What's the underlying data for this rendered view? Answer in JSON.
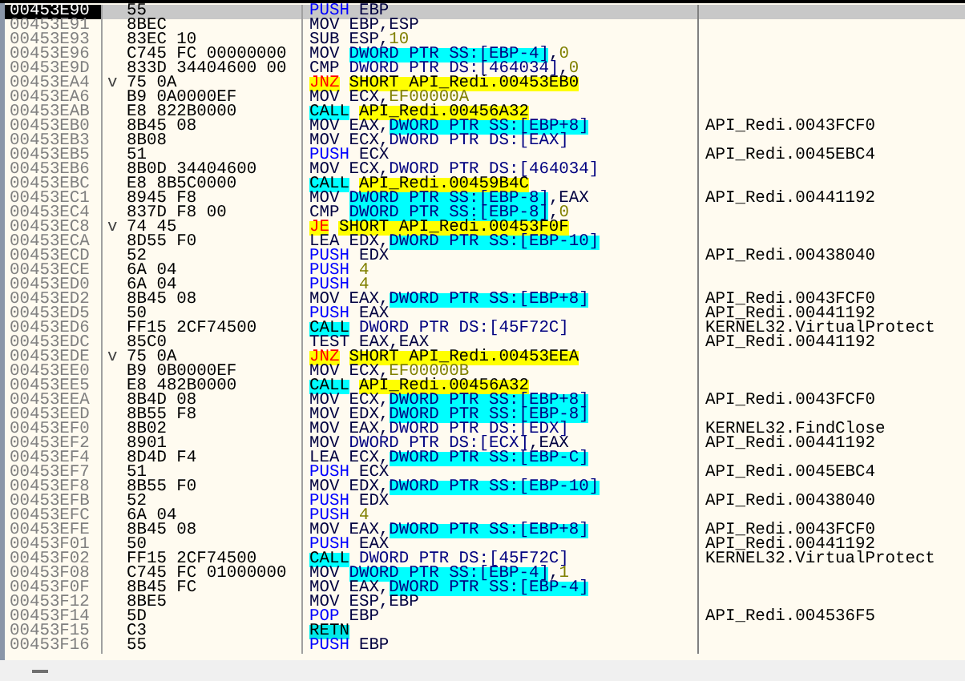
{
  "rows": [
    {
      "address": "00453E90",
      "hex": "55",
      "selected": true,
      "mnemonic": {
        "text": "PUSH",
        "kind": "stack_op"
      },
      "operands": [
        {
          "text": "EBP",
          "kind": "reg"
        }
      ]
    },
    {
      "address": "00453E91",
      "hex": "8BEC",
      "selected": false,
      "mnemonic": {
        "text": "MOV",
        "kind": "plain"
      },
      "operands": [
        {
          "text": "EBP,ESP",
          "kind": "reg"
        }
      ]
    },
    {
      "address": "00453E93",
      "hex": "83EC 10",
      "selected": false,
      "mnemonic": {
        "text": "SUB",
        "kind": "plain"
      },
      "operands": [
        {
          "text": "ESP,",
          "kind": "reg"
        },
        {
          "text": "10",
          "kind": "const"
        }
      ]
    },
    {
      "address": "00453E96",
      "hex": "C745 FC 00000000",
      "selected": false,
      "mnemonic": {
        "text": "MOV",
        "kind": "plain"
      },
      "operands": [
        {
          "text": "DWORD PTR SS:[EBP-4]",
          "kind": "stack"
        },
        {
          "text": ",",
          "kind": "reg"
        },
        {
          "text": "0",
          "kind": "const"
        }
      ]
    },
    {
      "address": "00453E9D",
      "hex": "833D 34404600 00",
      "selected": false,
      "mnemonic": {
        "text": "CMP",
        "kind": "plain"
      },
      "operands": [
        {
          "text": "DWORD PTR DS:[464034]",
          "kind": "mem"
        },
        {
          "text": ",",
          "kind": "reg"
        },
        {
          "text": "0",
          "kind": "const"
        }
      ]
    },
    {
      "address": "00453EA4",
      "arrow": "v",
      "hex": "75 0A",
      "selected": false,
      "mnemonic": {
        "text": "JNZ",
        "kind": "jump"
      },
      "operands": [
        {
          "text": "SHORT API_Redi.00453EB0",
          "kind": "target"
        }
      ]
    },
    {
      "address": "00453EA6",
      "hex": "B9 0A0000EF",
      "selected": false,
      "mnemonic": {
        "text": "MOV",
        "kind": "plain"
      },
      "operands": [
        {
          "text": "ECX,",
          "kind": "reg"
        },
        {
          "text": "EF00000A",
          "kind": "const"
        }
      ]
    },
    {
      "address": "00453EAB",
      "hex": "E8 822B0000",
      "selected": false,
      "mnemonic": {
        "text": "CALL",
        "kind": "call"
      },
      "operands": [
        {
          "text": "API_Redi.00456A32",
          "kind": "target"
        }
      ]
    },
    {
      "address": "00453EB0",
      "hex": "8B45 08",
      "selected": false,
      "mnemonic": {
        "text": "MOV",
        "kind": "plain"
      },
      "operands": [
        {
          "text": "EAX,",
          "kind": "reg"
        },
        {
          "text": "DWORD PTR SS:[EBP+8]",
          "kind": "stack"
        }
      ],
      "comment": "API_Redi.0043FCF0"
    },
    {
      "address": "00453EB3",
      "hex": "8B08",
      "selected": false,
      "mnemonic": {
        "text": "MOV",
        "kind": "plain"
      },
      "operands": [
        {
          "text": "ECX,",
          "kind": "reg"
        },
        {
          "text": "DWORD PTR DS:[EAX]",
          "kind": "mem"
        }
      ]
    },
    {
      "address": "00453EB5",
      "hex": "51",
      "selected": false,
      "mnemonic": {
        "text": "PUSH",
        "kind": "stack_op"
      },
      "operands": [
        {
          "text": "ECX",
          "kind": "reg"
        }
      ],
      "comment": "API_Redi.0045EBC4"
    },
    {
      "address": "00453EB6",
      "hex": "8B0D 34404600",
      "selected": false,
      "mnemonic": {
        "text": "MOV",
        "kind": "plain"
      },
      "operands": [
        {
          "text": "ECX,",
          "kind": "reg"
        },
        {
          "text": "DWORD PTR DS:[464034]",
          "kind": "mem"
        }
      ]
    },
    {
      "address": "00453EBC",
      "hex": "E8 8B5C0000",
      "selected": false,
      "mnemonic": {
        "text": "CALL",
        "kind": "call"
      },
      "operands": [
        {
          "text": "API_Redi.00459B4C",
          "kind": "target"
        }
      ]
    },
    {
      "address": "00453EC1",
      "hex": "8945 F8",
      "selected": false,
      "mnemonic": {
        "text": "MOV",
        "kind": "plain"
      },
      "operands": [
        {
          "text": "DWORD PTR SS:[EBP-8]",
          "kind": "stack"
        },
        {
          "text": ",EAX",
          "kind": "reg"
        }
      ],
      "comment": "API_Redi.00441192"
    },
    {
      "address": "00453EC4",
      "hex": "837D F8 00",
      "selected": false,
      "mnemonic": {
        "text": "CMP",
        "kind": "plain"
      },
      "operands": [
        {
          "text": "DWORD PTR SS:[EBP-8]",
          "kind": "stack"
        },
        {
          "text": ",",
          "kind": "reg"
        },
        {
          "text": "0",
          "kind": "const"
        }
      ]
    },
    {
      "address": "00453EC8",
      "arrow": "v",
      "hex": "74 45",
      "selected": false,
      "mnemonic": {
        "text": "JE",
        "kind": "jump"
      },
      "operands": [
        {
          "text": "SHORT API_Redi.00453F0F",
          "kind": "target"
        }
      ]
    },
    {
      "address": "00453ECA",
      "hex": "8D55 F0",
      "selected": false,
      "mnemonic": {
        "text": "LEA",
        "kind": "plain"
      },
      "operands": [
        {
          "text": "EDX,",
          "kind": "reg"
        },
        {
          "text": "DWORD PTR SS:[EBP-10]",
          "kind": "stack"
        }
      ]
    },
    {
      "address": "00453ECD",
      "hex": "52",
      "selected": false,
      "mnemonic": {
        "text": "PUSH",
        "kind": "stack_op"
      },
      "operands": [
        {
          "text": "EDX",
          "kind": "reg"
        }
      ],
      "comment": "API_Redi.00438040"
    },
    {
      "address": "00453ECE",
      "hex": "6A 04",
      "selected": false,
      "mnemonic": {
        "text": "PUSH",
        "kind": "stack_op"
      },
      "operands": [
        {
          "text": "4",
          "kind": "const"
        }
      ]
    },
    {
      "address": "00453ED0",
      "hex": "6A 04",
      "selected": false,
      "mnemonic": {
        "text": "PUSH",
        "kind": "stack_op"
      },
      "operands": [
        {
          "text": "4",
          "kind": "const"
        }
      ]
    },
    {
      "address": "00453ED2",
      "hex": "8B45 08",
      "selected": false,
      "mnemonic": {
        "text": "MOV",
        "kind": "plain"
      },
      "operands": [
        {
          "text": "EAX,",
          "kind": "reg"
        },
        {
          "text": "DWORD PTR SS:[EBP+8]",
          "kind": "stack"
        }
      ],
      "comment": "API_Redi.0043FCF0"
    },
    {
      "address": "00453ED5",
      "hex": "50",
      "selected": false,
      "mnemonic": {
        "text": "PUSH",
        "kind": "stack_op"
      },
      "operands": [
        {
          "text": "EAX",
          "kind": "reg"
        }
      ],
      "comment": "API_Redi.00441192"
    },
    {
      "address": "00453ED6",
      "hex": "FF15 2CF74500",
      "selected": false,
      "mnemonic": {
        "text": "CALL",
        "kind": "call"
      },
      "operands": [
        {
          "text": "DWORD PTR DS:[45F72C]",
          "kind": "mem"
        }
      ],
      "comment": "KERNEL32.VirtualProtect"
    },
    {
      "address": "00453EDC",
      "hex": "85C0",
      "selected": false,
      "mnemonic": {
        "text": "TEST",
        "kind": "plain"
      },
      "operands": [
        {
          "text": "EAX,EAX",
          "kind": "reg"
        }
      ],
      "comment": "API_Redi.00441192"
    },
    {
      "address": "00453EDE",
      "arrow": "v",
      "hex": "75 0A",
      "selected": false,
      "mnemonic": {
        "text": "JNZ",
        "kind": "jump"
      },
      "operands": [
        {
          "text": "SHORT API_Redi.00453EEA",
          "kind": "target"
        }
      ]
    },
    {
      "address": "00453EE0",
      "hex": "B9 0B0000EF",
      "selected": false,
      "mnemonic": {
        "text": "MOV",
        "kind": "plain"
      },
      "operands": [
        {
          "text": "ECX,",
          "kind": "reg"
        },
        {
          "text": "EF00000B",
          "kind": "const"
        }
      ]
    },
    {
      "address": "00453EE5",
      "hex": "E8 482B0000",
      "selected": false,
      "mnemonic": {
        "text": "CALL",
        "kind": "call"
      },
      "operands": [
        {
          "text": "API_Redi.00456A32",
          "kind": "target"
        }
      ]
    },
    {
      "address": "00453EEA",
      "hex": "8B4D 08",
      "selected": false,
      "mnemonic": {
        "text": "MOV",
        "kind": "plain"
      },
      "operands": [
        {
          "text": "ECX,",
          "kind": "reg"
        },
        {
          "text": "DWORD PTR SS:[EBP+8]",
          "kind": "stack"
        }
      ],
      "comment": "API_Redi.0043FCF0"
    },
    {
      "address": "00453EED",
      "hex": "8B55 F8",
      "selected": false,
      "mnemonic": {
        "text": "MOV",
        "kind": "plain"
      },
      "operands": [
        {
          "text": "EDX,",
          "kind": "reg"
        },
        {
          "text": "DWORD PTR SS:[EBP-8]",
          "kind": "stack"
        }
      ]
    },
    {
      "address": "00453EF0",
      "hex": "8B02",
      "selected": false,
      "mnemonic": {
        "text": "MOV",
        "kind": "plain"
      },
      "operands": [
        {
          "text": "EAX,",
          "kind": "reg"
        },
        {
          "text": "DWORD PTR DS:[EDX]",
          "kind": "mem"
        }
      ],
      "comment": "KERNEL32.FindClose"
    },
    {
      "address": "00453EF2",
      "hex": "8901",
      "selected": false,
      "mnemonic": {
        "text": "MOV",
        "kind": "plain"
      },
      "operands": [
        {
          "text": "DWORD PTR DS:[ECX]",
          "kind": "mem"
        },
        {
          "text": ",EAX",
          "kind": "reg"
        }
      ],
      "comment": "API_Redi.00441192"
    },
    {
      "address": "00453EF4",
      "hex": "8D4D F4",
      "selected": false,
      "mnemonic": {
        "text": "LEA",
        "kind": "plain"
      },
      "operands": [
        {
          "text": "ECX,",
          "kind": "reg"
        },
        {
          "text": "DWORD PTR SS:[EBP-C]",
          "kind": "stack"
        }
      ]
    },
    {
      "address": "00453EF7",
      "hex": "51",
      "selected": false,
      "mnemonic": {
        "text": "PUSH",
        "kind": "stack_op"
      },
      "operands": [
        {
          "text": "ECX",
          "kind": "reg"
        }
      ],
      "comment": "API_Redi.0045EBC4"
    },
    {
      "address": "00453EF8",
      "hex": "8B55 F0",
      "selected": false,
      "mnemonic": {
        "text": "MOV",
        "kind": "plain"
      },
      "operands": [
        {
          "text": "EDX,",
          "kind": "reg"
        },
        {
          "text": "DWORD PTR SS:[EBP-10]",
          "kind": "stack"
        }
      ]
    },
    {
      "address": "00453EFB",
      "hex": "52",
      "selected": false,
      "mnemonic": {
        "text": "PUSH",
        "kind": "stack_op"
      },
      "operands": [
        {
          "text": "EDX",
          "kind": "reg"
        }
      ],
      "comment": "API_Redi.00438040"
    },
    {
      "address": "00453EFC",
      "hex": "6A 04",
      "selected": false,
      "mnemonic": {
        "text": "PUSH",
        "kind": "stack_op"
      },
      "operands": [
        {
          "text": "4",
          "kind": "const"
        }
      ]
    },
    {
      "address": "00453EFE",
      "hex": "8B45 08",
      "selected": false,
      "mnemonic": {
        "text": "MOV",
        "kind": "plain"
      },
      "operands": [
        {
          "text": "EAX,",
          "kind": "reg"
        },
        {
          "text": "DWORD PTR SS:[EBP+8]",
          "kind": "stack"
        }
      ],
      "comment": "API_Redi.0043FCF0"
    },
    {
      "address": "00453F01",
      "hex": "50",
      "selected": false,
      "mnemonic": {
        "text": "PUSH",
        "kind": "stack_op"
      },
      "operands": [
        {
          "text": "EAX",
          "kind": "reg"
        }
      ],
      "comment": "API_Redi.00441192"
    },
    {
      "address": "00453F02",
      "hex": "FF15 2CF74500",
      "selected": false,
      "mnemonic": {
        "text": "CALL",
        "kind": "call"
      },
      "operands": [
        {
          "text": "DWORD PTR DS:[45F72C]",
          "kind": "mem"
        }
      ],
      "comment": "KERNEL32.VirtualProtect"
    },
    {
      "address": "00453F08",
      "hex": "C745 FC 01000000",
      "selected": false,
      "mnemonic": {
        "text": "MOV",
        "kind": "plain"
      },
      "operands": [
        {
          "text": "DWORD PTR SS:[EBP-4]",
          "kind": "stack"
        },
        {
          "text": ",",
          "kind": "reg"
        },
        {
          "text": "1",
          "kind": "const"
        }
      ]
    },
    {
      "address": "00453F0F",
      "hex": "8B45 FC",
      "selected": false,
      "mnemonic": {
        "text": "MOV",
        "kind": "plain"
      },
      "operands": [
        {
          "text": "EAX,",
          "kind": "reg"
        },
        {
          "text": "DWORD PTR SS:[EBP-4]",
          "kind": "stack"
        }
      ]
    },
    {
      "address": "00453F12",
      "hex": "8BE5",
      "selected": false,
      "mnemonic": {
        "text": "MOV",
        "kind": "plain"
      },
      "operands": [
        {
          "text": "ESP,EBP",
          "kind": "reg"
        }
      ]
    },
    {
      "address": "00453F14",
      "hex": "5D",
      "selected": false,
      "mnemonic": {
        "text": "POP",
        "kind": "stack_op"
      },
      "operands": [
        {
          "text": "EBP",
          "kind": "reg"
        }
      ],
      "comment": "API_Redi.004536F5"
    },
    {
      "address": "00453F15",
      "hex": "C3",
      "selected": false,
      "mnemonic": {
        "text": "RETN",
        "kind": "ret"
      },
      "operands": []
    },
    {
      "address": "00453F16",
      "hex": "55",
      "selected": false,
      "mnemonic": {
        "text": "PUSH",
        "kind": "stack_op"
      },
      "operands": [
        {
          "text": "EBP",
          "kind": "reg"
        }
      ]
    }
  ]
}
